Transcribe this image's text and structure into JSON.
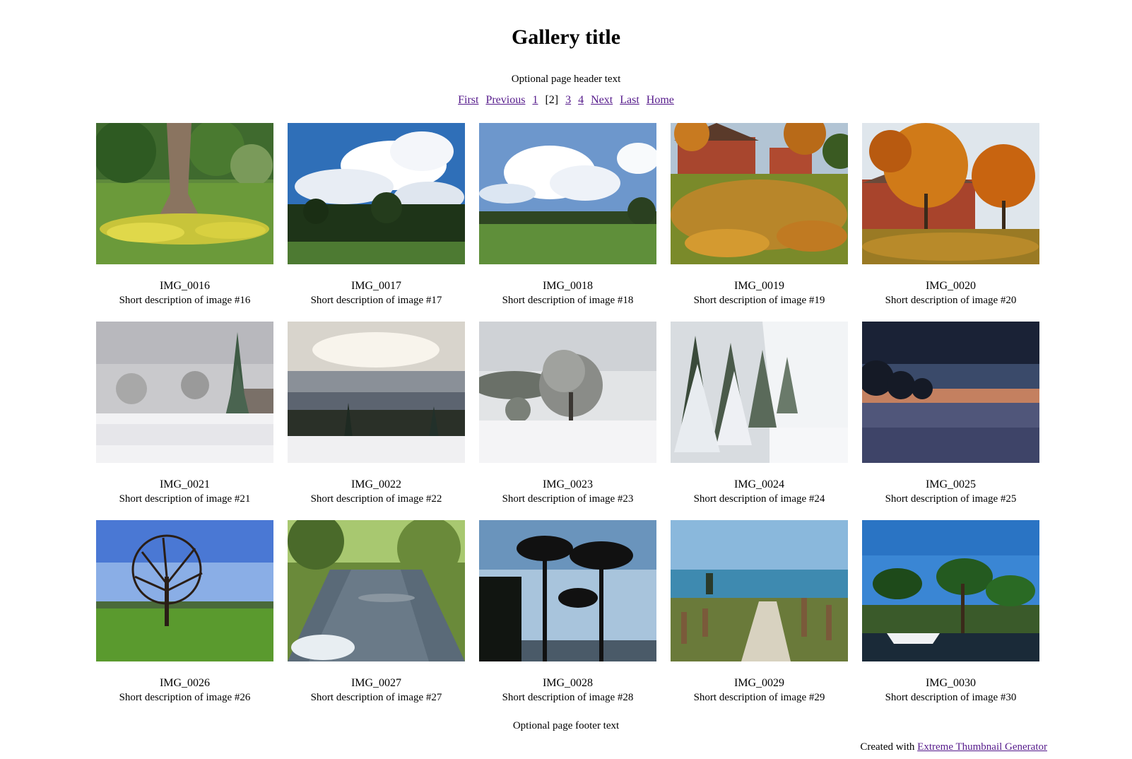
{
  "title": "Gallery title",
  "header_text": "Optional page header text",
  "pager": {
    "first": "First",
    "previous": "Previous",
    "page1": "1",
    "current": "[2]",
    "page3": "3",
    "page4": "4",
    "next": "Next",
    "last": "Last",
    "home": "Home"
  },
  "images": [
    {
      "name": "IMG_0016",
      "desc": "Short description of image #16"
    },
    {
      "name": "IMG_0017",
      "desc": "Short description of image #17"
    },
    {
      "name": "IMG_0018",
      "desc": "Short description of image #18"
    },
    {
      "name": "IMG_0019",
      "desc": "Short description of image #19"
    },
    {
      "name": "IMG_0020",
      "desc": "Short description of image #20"
    },
    {
      "name": "IMG_0021",
      "desc": "Short description of image #21"
    },
    {
      "name": "IMG_0022",
      "desc": "Short description of image #22"
    },
    {
      "name": "IMG_0023",
      "desc": "Short description of image #23"
    },
    {
      "name": "IMG_0024",
      "desc": "Short description of image #24"
    },
    {
      "name": "IMG_0025",
      "desc": "Short description of image #25"
    },
    {
      "name": "IMG_0026",
      "desc": "Short description of image #26"
    },
    {
      "name": "IMG_0027",
      "desc": "Short description of image #27"
    },
    {
      "name": "IMG_0028",
      "desc": "Short description of image #28"
    },
    {
      "name": "IMG_0029",
      "desc": "Short description of image #29"
    },
    {
      "name": "IMG_0030",
      "desc": "Short description of image #30"
    }
  ],
  "footer_text": "Optional page footer text",
  "credit": {
    "prefix": "Created with",
    "link": "Extreme Thumbnail Generator"
  },
  "colors": {
    "link": "#551a8b",
    "background": "#ffffff"
  }
}
